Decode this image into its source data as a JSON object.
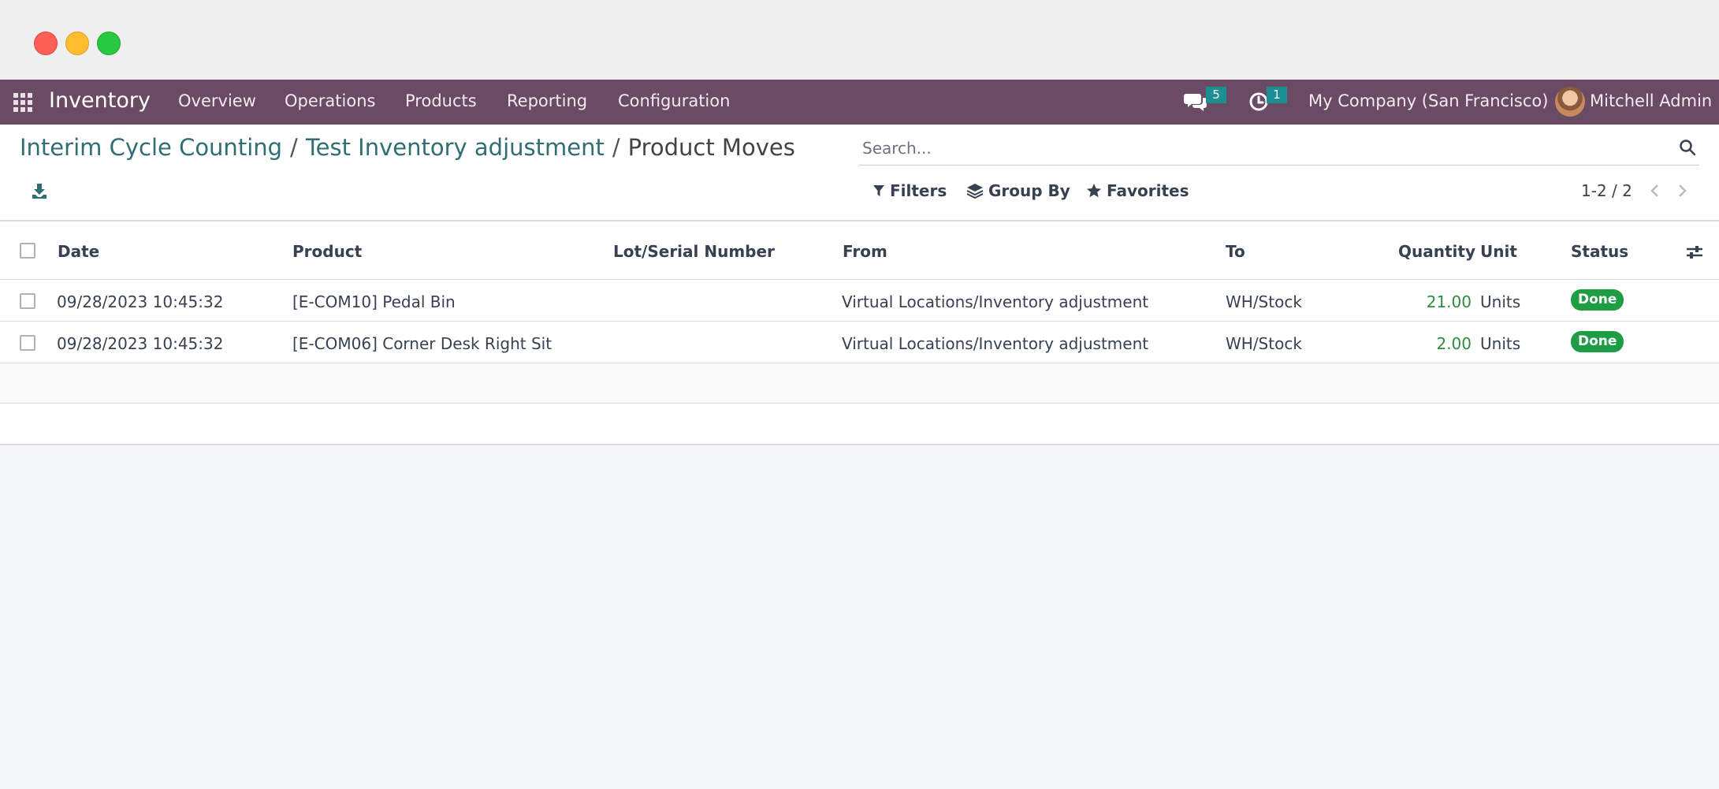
{
  "navbar": {
    "app_name": "Inventory",
    "menu": [
      "Overview",
      "Operations",
      "Products",
      "Reporting",
      "Configuration"
    ],
    "messages_count": "5",
    "activities_count": "1",
    "company": "My Company (San Francisco)",
    "user": "Mitchell Admin"
  },
  "breadcrumb": {
    "items": [
      "Interim Cycle Counting",
      "Test Inventory adjustment"
    ],
    "separator": "/",
    "current": "Product Moves"
  },
  "search": {
    "placeholder": "Search..."
  },
  "filters": {
    "filters_label": "Filters",
    "group_by_label": "Group By",
    "favorites_label": "Favorites"
  },
  "pager": {
    "text": "1-2 / 2"
  },
  "table": {
    "columns": [
      "Date",
      "Product",
      "Lot/Serial Number",
      "From",
      "To",
      "Quantity",
      "Unit",
      "Status"
    ],
    "rows": [
      {
        "date": "09/28/2023 10:45:32",
        "product": "[E-COM10] Pedal Bin",
        "lot": "",
        "from": "Virtual Locations/Inventory adjustment",
        "to": "WH/Stock",
        "quantity": "21.00",
        "unit": "Units",
        "status": "Done"
      },
      {
        "date": "09/28/2023 10:45:32",
        "product": "[E-COM06] Corner Desk Right Sit",
        "lot": "",
        "from": "Virtual Locations/Inventory adjustment",
        "to": "WH/Stock",
        "quantity": "2.00",
        "unit": "Units",
        "status": "Done"
      }
    ]
  },
  "colors": {
    "navbar": "#6b4a64",
    "link": "#2f6f73",
    "badge": "#1c8f94",
    "done": "#1f9d45",
    "quantity": "#2e8b3e"
  }
}
